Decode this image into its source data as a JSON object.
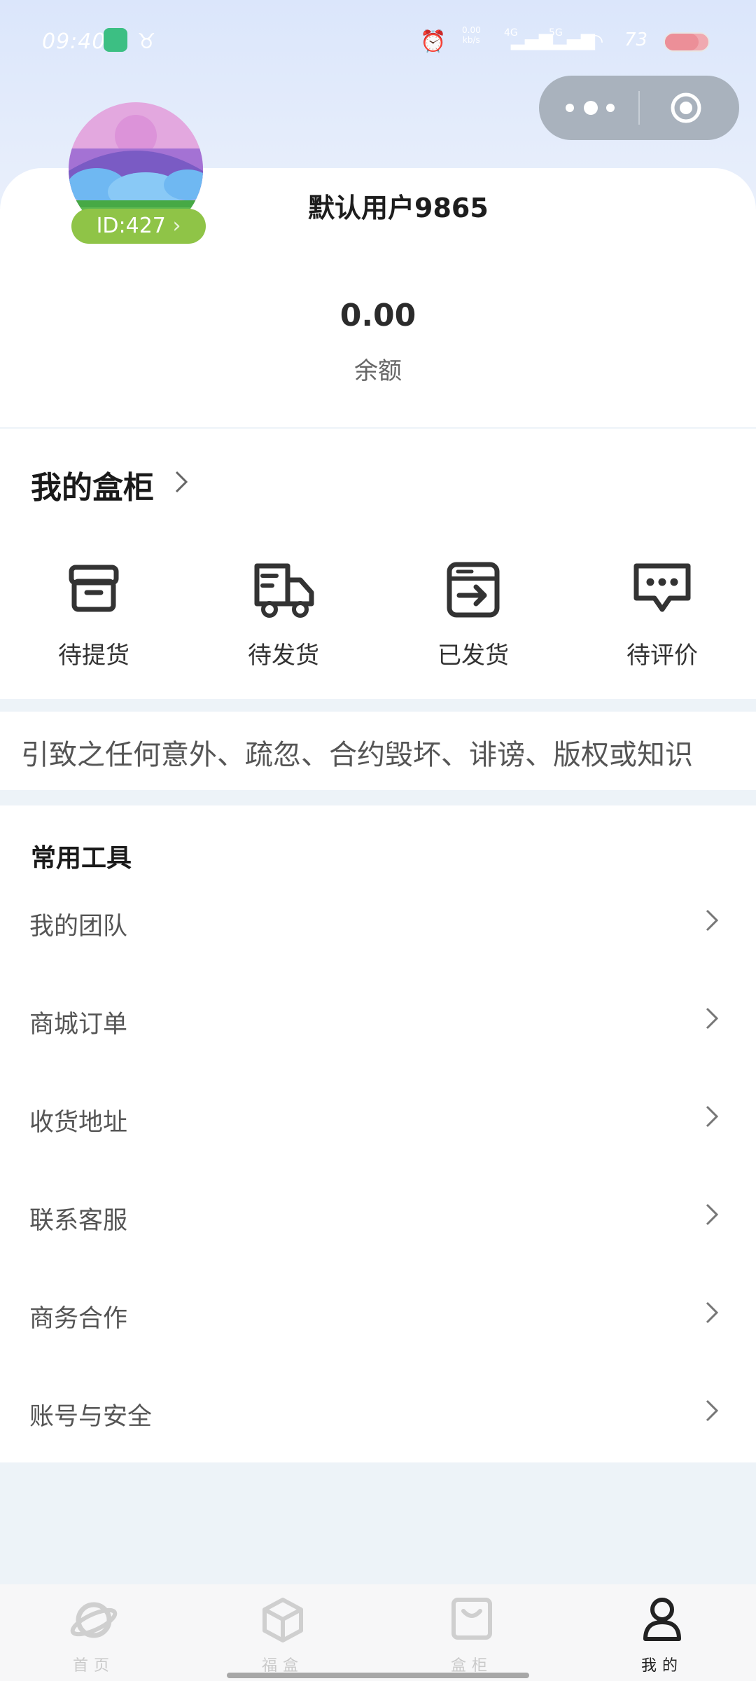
{
  "status_bar": {
    "time": "09:40",
    "network_speed_top": "0.00",
    "network_speed_bottom": "kb/s",
    "signal_1": "4G",
    "signal_2": "5G",
    "battery": "73"
  },
  "capsule": {
    "more_icon": "more-dots-icon",
    "close_icon": "target-icon"
  },
  "profile": {
    "username": "默认用户9865",
    "id_badge": "ID:427",
    "balance_value": "0.00",
    "balance_label": "余额"
  },
  "my_box": {
    "title": "我的盒柜",
    "actions": [
      {
        "label": "待提货",
        "icon": "box-icon"
      },
      {
        "label": "待发货",
        "icon": "truck-icon"
      },
      {
        "label": "已发货",
        "icon": "shipped-box-icon"
      },
      {
        "label": "待评价",
        "icon": "comment-icon"
      }
    ]
  },
  "notice": {
    "text": "引致之任何意外、疏忽、合约毁坏、诽谤、版权或知识"
  },
  "tools": {
    "title": "常用工具",
    "items": [
      {
        "label": "我的团队"
      },
      {
        "label": "商城订单"
      },
      {
        "label": "收货地址"
      },
      {
        "label": "联系客服"
      },
      {
        "label": "商务合作"
      },
      {
        "label": "账号与安全"
      }
    ]
  },
  "tabbar": {
    "tabs": [
      {
        "label": "首页",
        "icon": "planet-icon",
        "active": false
      },
      {
        "label": "福盒",
        "icon": "cube-icon",
        "active": false
      },
      {
        "label": "盒柜",
        "icon": "bag-icon",
        "active": false
      },
      {
        "label": "我的",
        "icon": "person-icon",
        "active": true
      }
    ]
  },
  "colors": {
    "id_badge": "#8fc447",
    "accent_text": "#1a1a1a",
    "tab_active": "#222222",
    "tab_inactive": "#c9c9c9"
  }
}
